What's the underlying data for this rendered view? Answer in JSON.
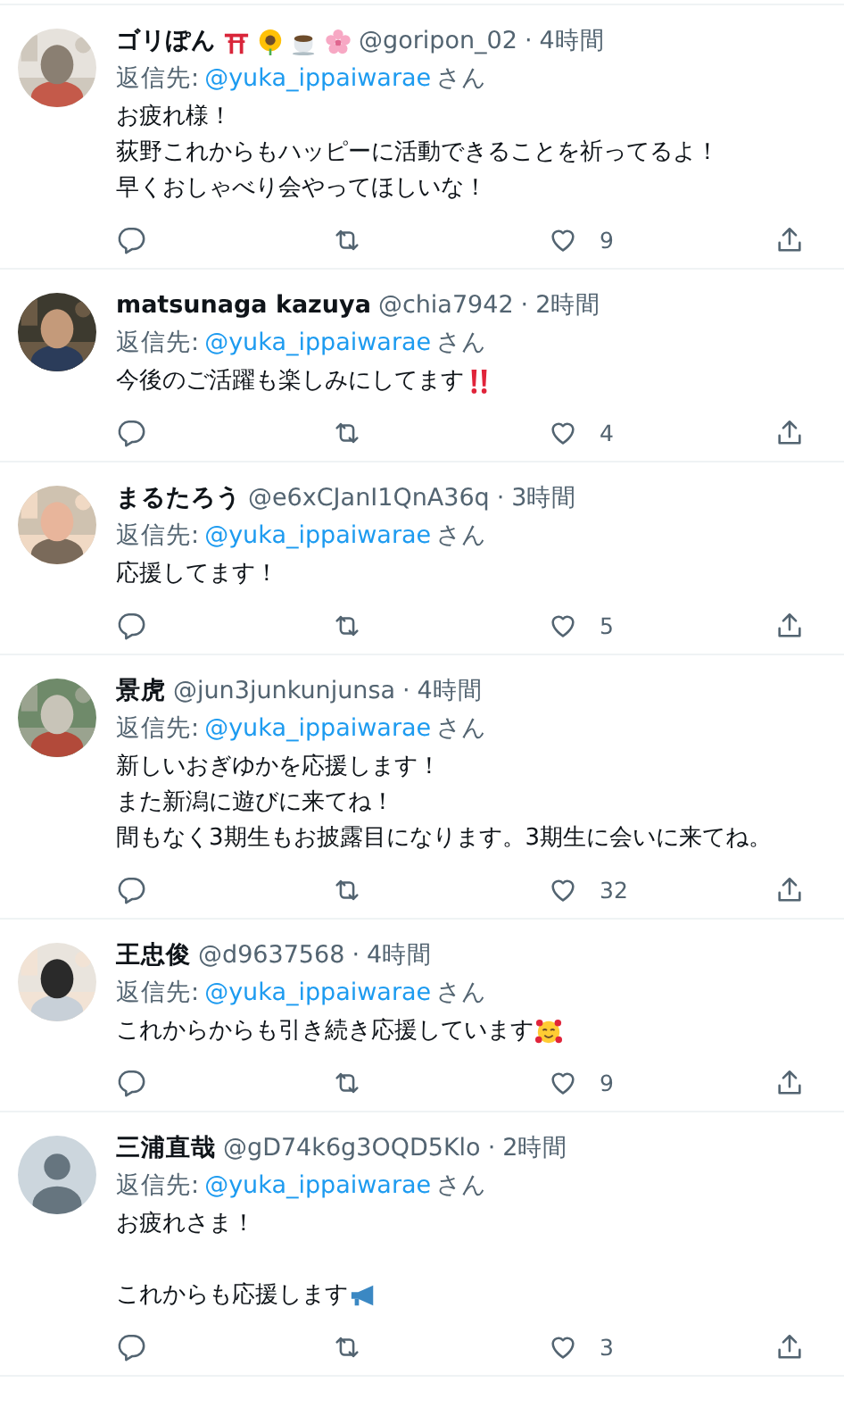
{
  "replies": [
    {
      "name": "ゴリぽん",
      "name_bold": true,
      "name_icons": [
        {
          "kind": "torii"
        },
        {
          "kind": "sunflower"
        },
        {
          "kind": "coffee"
        },
        {
          "kind": "blossom"
        }
      ],
      "handle": "@goripon_02",
      "dot": "·",
      "time": "4時間",
      "reply_prefix": "返信先:",
      "reply_to": "@yuka_ippaiwarae",
      "reply_suffix": "さん",
      "paragraphs": [
        [
          "お疲れ様！",
          "荻野これからもハッピーに活動できることを祈ってるよ！",
          "早くおしゃべり会やってほしいな！"
        ]
      ],
      "avatar": {
        "kind": "picture"
      },
      "likes": "9"
    },
    {
      "name": "matsunaga kazuya",
      "name_bold": true,
      "handle": "@chia7942",
      "dot": "·",
      "time": "2時間",
      "reply_prefix": "返信先:",
      "reply_to": "@yuka_ippaiwarae",
      "reply_suffix": "さん",
      "paragraphs": [
        [
          "今後のご活躍も楽しみにしてます"
        ]
      ],
      "trailing_icon": {
        "kind": "exclaim"
      },
      "avatar": {
        "kind": "picture"
      },
      "likes": "4"
    },
    {
      "name": "まるたろう",
      "name_bold": true,
      "handle": "@e6xCJanI1QnA36q",
      "dot": "·",
      "time": "3時間",
      "reply_prefix": "返信先:",
      "reply_to": "@yuka_ippaiwarae",
      "reply_suffix": "さん",
      "paragraphs": [
        [
          "応援してます！"
        ]
      ],
      "avatar": {
        "kind": "picture"
      },
      "likes": "5"
    },
    {
      "name": "景虎",
      "name_bold": true,
      "handle": "@jun3junkunjunsa",
      "dot": "·",
      "time": "4時間",
      "reply_prefix": "返信先:",
      "reply_to": "@yuka_ippaiwarae",
      "reply_suffix": "さん",
      "paragraphs": [
        [
          "新しいおぎゆかを応援します！",
          "また新潟に遊びに来てね！",
          "間もなく3期生もお披露目になります。3期生に会いに来てね。"
        ]
      ],
      "avatar": {
        "kind": "picture"
      },
      "likes": "32"
    },
    {
      "name": "王忠俊",
      "name_bold": true,
      "handle": "@d9637568",
      "dot": "·",
      "time": "4時間",
      "reply_prefix": "返信先:",
      "reply_to": "@yuka_ippaiwarae",
      "reply_suffix": "さん",
      "paragraphs": [
        [
          "これからからも引き続き応援しています"
        ]
      ],
      "trailing_icon": {
        "kind": "hearts-face"
      },
      "avatar": {
        "kind": "picture"
      },
      "likes": "9"
    },
    {
      "name": "三浦直哉",
      "name_bold": true,
      "handle": "@gD74k6g3OQD5Klo",
      "dot": "·",
      "time": "2時間",
      "reply_prefix": "返信先:",
      "reply_to": "@yuka_ippaiwarae",
      "reply_suffix": "さん",
      "paragraphs": [
        [
          "お疲れさま！"
        ],
        [
          "これからも応援します"
        ]
      ],
      "trailing_icon": {
        "kind": "megaphone"
      },
      "avatar": {
        "kind": "default"
      },
      "likes": "3"
    }
  ]
}
